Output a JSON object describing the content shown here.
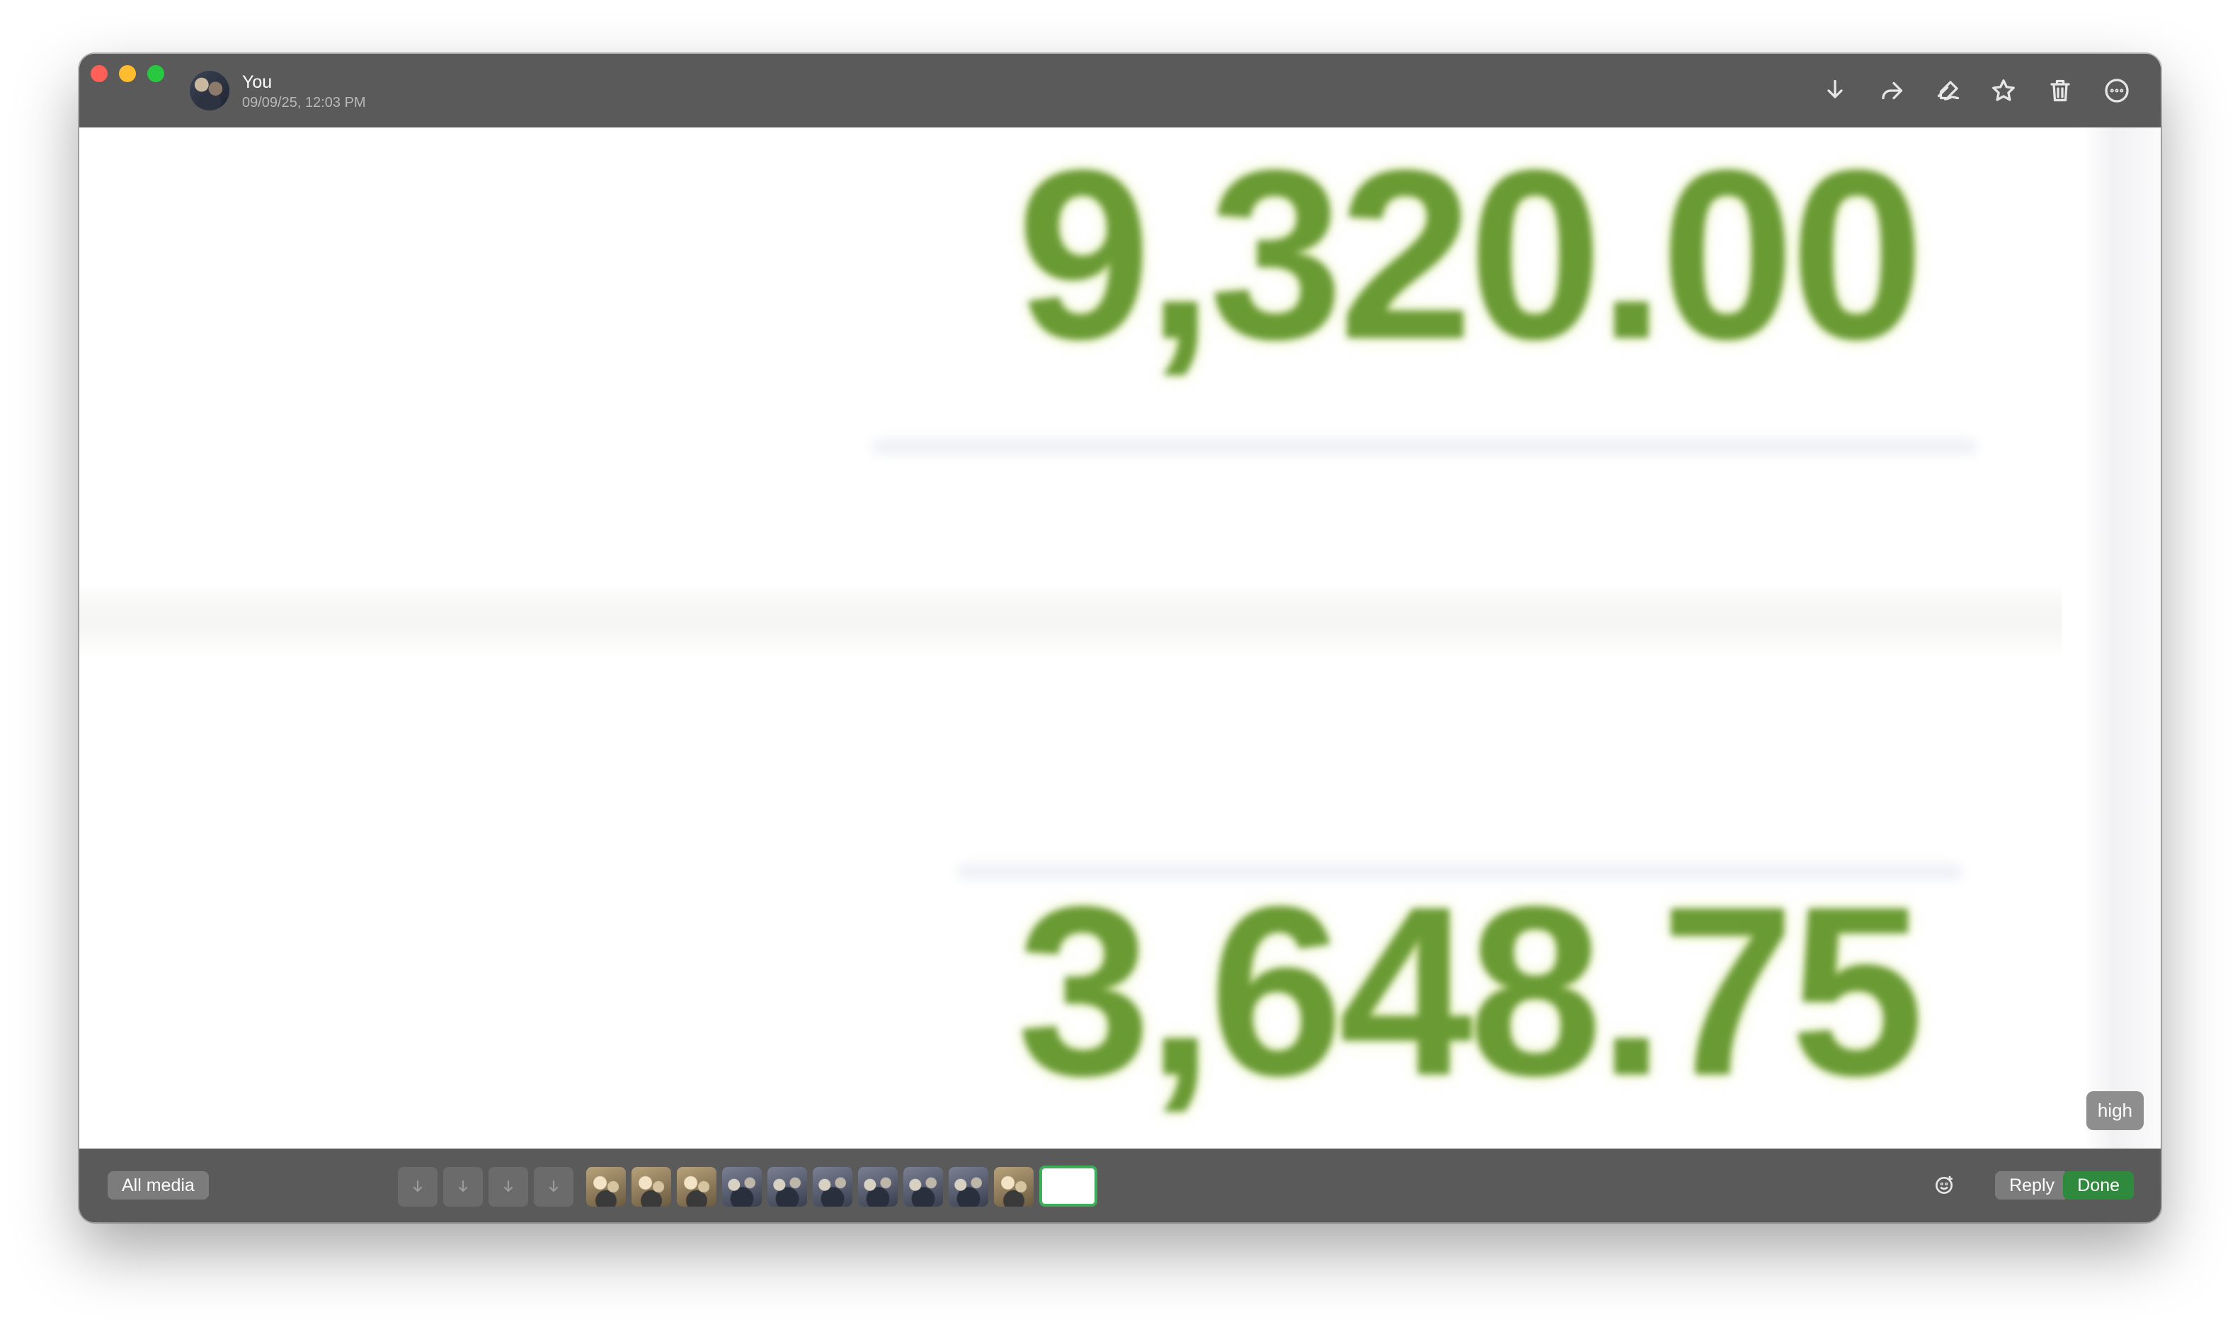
{
  "window": {
    "sender_name": "You",
    "timestamp": "09/09/25, 12:03 PM"
  },
  "toolbar": {
    "icons": [
      "download-icon",
      "forward-icon",
      "markup-icon",
      "star-icon",
      "trash-icon",
      "more-icon"
    ]
  },
  "image_content": {
    "amount_top": "9,320.00",
    "amount_bottom": "3,648.75",
    "amount_color": "#6a9a34"
  },
  "quality_badge": "high",
  "bottombar": {
    "all_media_label": "All media",
    "reply_label": "Reply",
    "done_label": "Done",
    "done_color": "#2f8a3e",
    "download_slots": 4,
    "thumbnails": [
      "warm",
      "warm",
      "warm",
      "cool",
      "cool",
      "cool",
      "cool",
      "cool",
      "cool",
      "warm"
    ],
    "selected_thumbnail": "blank-white",
    "selected_border_color": "#3fae5a"
  }
}
